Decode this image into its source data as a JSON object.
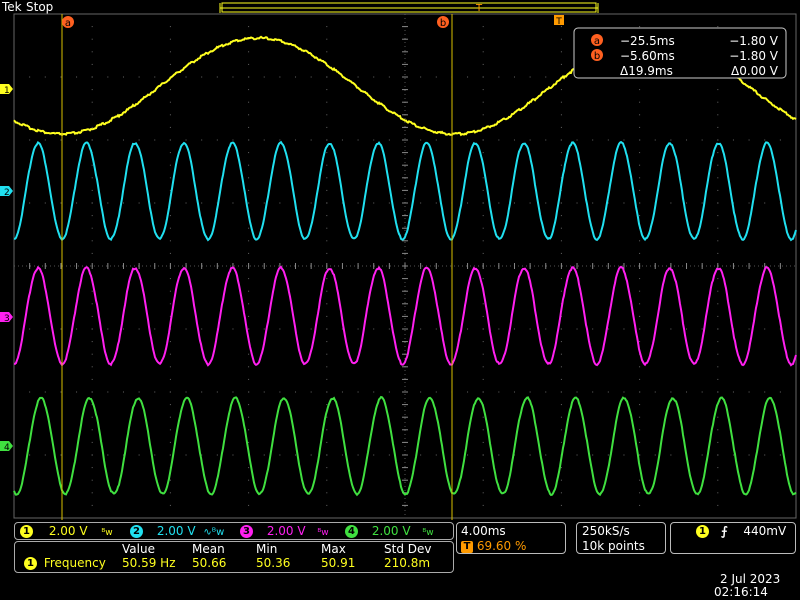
{
  "header": {
    "brand": "Tek",
    "state": "Stop",
    "trigger_marker": "T"
  },
  "colors": {
    "ch1": "#ffff20",
    "ch2": "#20e0f0",
    "ch3": "#ff20f0",
    "ch4": "#40e040",
    "cursor_label": "#ff6020",
    "trigger": "#ff9a00",
    "grid": "#555555"
  },
  "cursors": {
    "a": {
      "label": "a",
      "time": "−25.5ms",
      "voltage": "−1.80 V"
    },
    "b": {
      "label": "b",
      "time": "−5.60ms",
      "voltage": "−1.80 V"
    },
    "delta_time": "Δ19.9ms",
    "delta_voltage": "Δ0.00 V"
  },
  "channels": [
    {
      "num": "1",
      "scale": "2.00 V"
    },
    {
      "num": "2",
      "scale": "2.00 V"
    },
    {
      "num": "3",
      "scale": "2.00 V"
    },
    {
      "num": "4",
      "scale": "2.00 V"
    }
  ],
  "horizontal": {
    "timebase": "4.00ms",
    "trigger_pos_label": "T",
    "trigger_pos": "69.60 %"
  },
  "acquisition": {
    "rate": "250kS/s",
    "record": "10k points"
  },
  "trigger": {
    "source": "1",
    "slope_icon": "rising-edge",
    "level": "440mV"
  },
  "measurement": {
    "source": "1",
    "name": "Frequency",
    "headers": [
      "Value",
      "Mean",
      "Min",
      "Max",
      "Std Dev"
    ],
    "values": [
      "50.59 Hz",
      "50.66",
      "50.36",
      "50.91",
      "210.8m"
    ]
  },
  "clock": {
    "date": "2 Jul   2023",
    "time": "02:16:14"
  }
}
